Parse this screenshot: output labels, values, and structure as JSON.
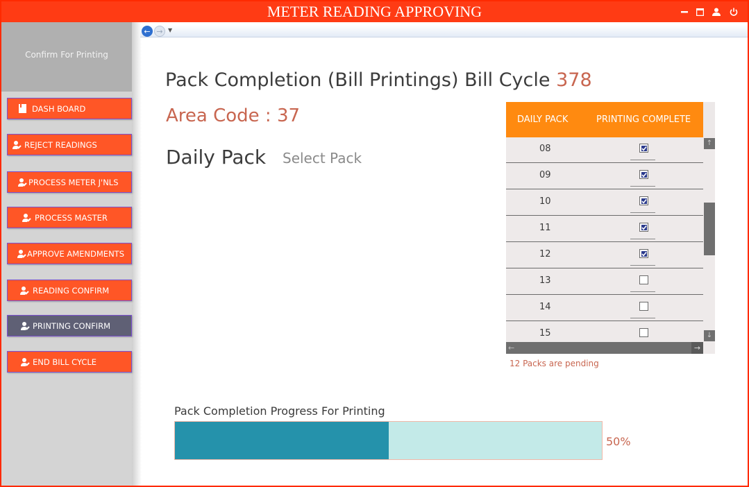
{
  "window": {
    "title": "METER READING APPROVING",
    "accent_color": "#ff3b14"
  },
  "titlebar_icons": [
    "minimize-icon",
    "maximize-icon",
    "user-icon",
    "power-icon"
  ],
  "sidebar": {
    "header": "Confirm For Printing",
    "items": [
      {
        "label": "DASH BOARD",
        "icon": "document-icon",
        "active": false
      },
      {
        "label": "REJECT READINGS",
        "icon": "user-edit-icon",
        "active": false
      },
      {
        "label": "PROCESS METER J'NLS",
        "icon": "user-edit-icon",
        "active": false
      },
      {
        "label": "PROCESS MASTER",
        "icon": "user-edit-icon",
        "active": false
      },
      {
        "label": "APPROVE AMENDMENTS",
        "icon": "user-edit-icon",
        "active": false
      },
      {
        "label": "READING CONFIRM",
        "icon": "user-edit-icon",
        "active": false
      },
      {
        "label": "PRINTING CONFIRM",
        "icon": "user-edit-icon",
        "active": true
      },
      {
        "label": "END BILL CYCLE",
        "icon": "user-edit-icon",
        "active": false
      }
    ]
  },
  "main": {
    "heading": "Pack Completion (Bill Printings) Bill Cycle",
    "bill_cycle": "378",
    "area_code": "Area Code : 37",
    "daily_pack_label": "Daily Pack",
    "select_pack": "Select Pack"
  },
  "grid": {
    "headers": [
      "DAILY PACK",
      "PRINTING COMPLETE"
    ],
    "rows": [
      {
        "pack": "08",
        "complete": true
      },
      {
        "pack": "09",
        "complete": true
      },
      {
        "pack": "10",
        "complete": true
      },
      {
        "pack": "11",
        "complete": true
      },
      {
        "pack": "12",
        "complete": true
      },
      {
        "pack": "13",
        "complete": false
      },
      {
        "pack": "14",
        "complete": false
      },
      {
        "pack": "15",
        "complete": false
      }
    ]
  },
  "pending_text": "12 Packs are pending",
  "progress": {
    "label": "Pack Completion Progress For Printing",
    "percent_text": "50%",
    "value": 0.5,
    "fill_color": "#2592ab",
    "track_color": "#c3eae8"
  }
}
